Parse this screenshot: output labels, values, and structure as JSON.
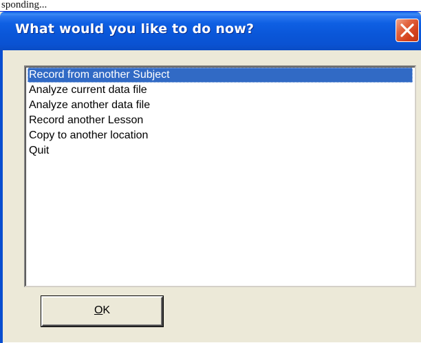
{
  "caption_above": "sponding...",
  "dialog": {
    "title": "What would you like to do now?",
    "options": [
      {
        "label": "Record from another Subject",
        "selected": true
      },
      {
        "label": "Analyze current data file",
        "selected": false
      },
      {
        "label": "Analyze another data file",
        "selected": false
      },
      {
        "label": "Record another Lesson",
        "selected": false
      },
      {
        "label": "Copy to another location",
        "selected": false
      },
      {
        "label": "Quit",
        "selected": false
      }
    ],
    "ok_button": {
      "mnemonic": "O",
      "rest": "K"
    }
  },
  "colors": {
    "titlebar": "#0a56d8",
    "selection": "#316ac5",
    "close_button": "#d3411c",
    "dialog_face": "#ece9d8"
  },
  "icons": {
    "close": "close-icon"
  }
}
